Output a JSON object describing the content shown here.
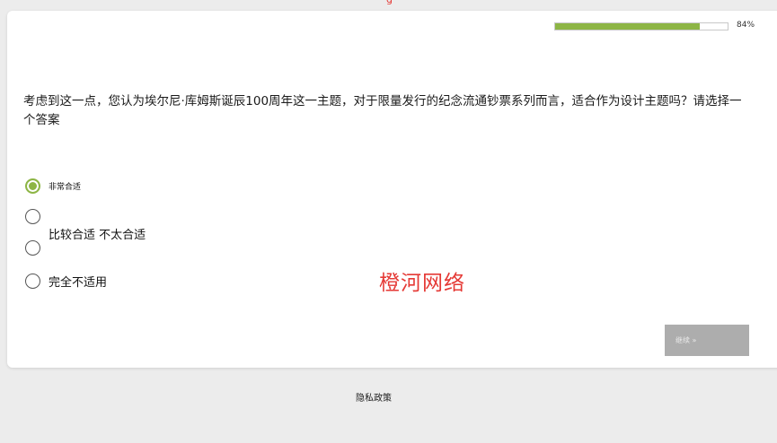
{
  "header": {
    "top_mark": "g"
  },
  "progress": {
    "percent": 84,
    "label": "84%",
    "fill_color": "#8db545"
  },
  "question": {
    "text": "考虑到这一点，您认为埃尔尼·库姆斯诞辰100周年这一主题，对于限量发行的纪念流通钞票系列而言，适合作为设计主题吗？请选择一个答案"
  },
  "options": [
    {
      "label": "非常合适",
      "selected": true
    },
    {
      "label": "",
      "selected": false
    },
    {
      "label": "",
      "selected": false
    },
    {
      "label": "完全不适用",
      "selected": false
    }
  ],
  "merged_label": "比较合适 不太合适",
  "watermark": "橙河网络",
  "buttons": {
    "continue_label": "继续 »"
  },
  "footer": {
    "privacy_label": "隐私政策"
  },
  "colors": {
    "accent": "#8db545",
    "watermark": "#e53935",
    "button_bg": "#adadad"
  }
}
